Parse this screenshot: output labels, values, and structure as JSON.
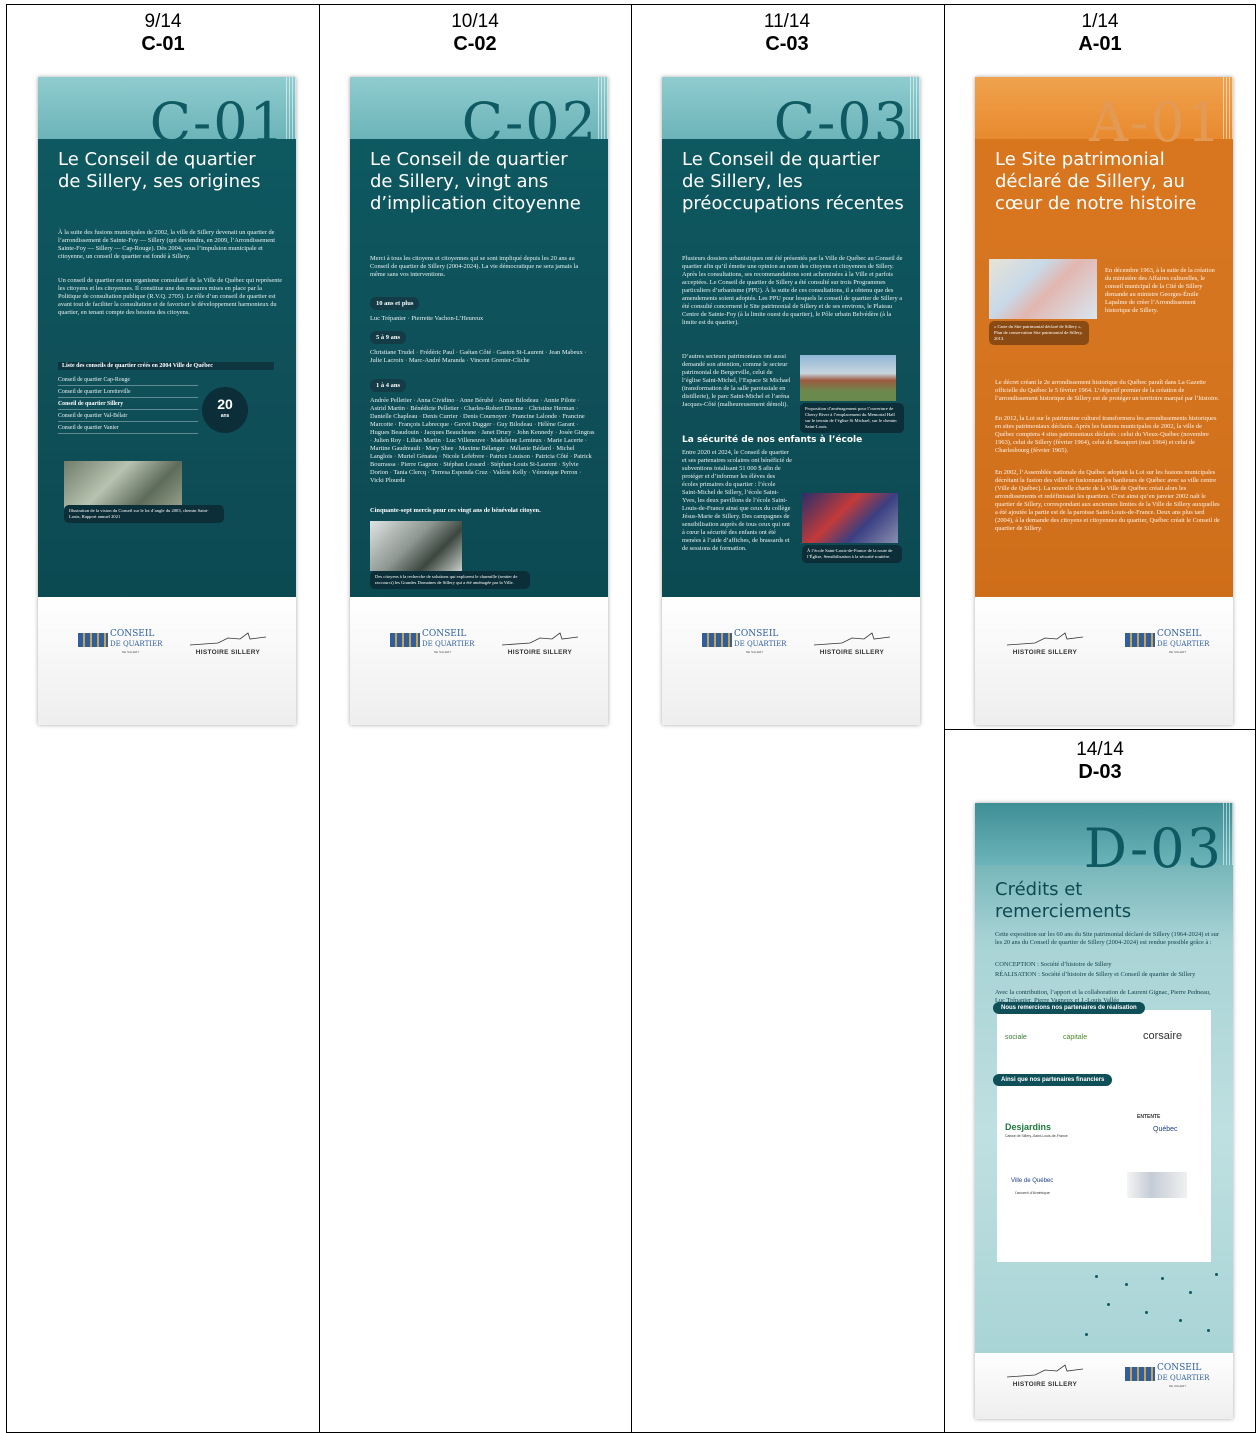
{
  "columns": [
    {
      "num": "9/14",
      "code": "C-01"
    },
    {
      "num": "10/14",
      "code": "C-02"
    },
    {
      "num": "11/14",
      "code": "C-03"
    },
    {
      "num": "1/14",
      "code": "A-01"
    }
  ],
  "extra_cell": {
    "num": "14/14",
    "code": "D-03"
  },
  "panels": {
    "c01": {
      "code": "C-01",
      "title": "Le Conseil de quartier de Sillery, ses origines",
      "p1": "À la suite des fusions municipales de 2002, la ville de Sillery devenait un quartier de l’arrondissement de Sainte-Foy — Sillery (qui deviendra, en 2009, l’Arrondissement Sainte-Foy — Sillery — Cap-Rouge). Dès 2004, sous l’impulsion municipale et citoyenne, un conseil de quartier est fondé à Sillery.",
      "p2": "Un conseil de quartier est un organisme consultatif de la Ville de Québec qui représente les citoyens et les citoyennes. Il constitue une des mesures mises en place par la Politique de consultation publique (R.V.Q. 2705). Le rôle d’un conseil de quartier est avant tout de faciliter la consultation et de favoriser le développement harmonieux du quartier, en tenant compte des besoins des citoyens.",
      "list_title": "Liste des conseils de quartier créés en 2004 Ville de Québec",
      "list": [
        "Conseil de quartier Cap-Rouge",
        "Conseil de quartier Loretteville",
        "Conseil de quartier Sillery",
        "Conseil de quartier Val-Bélair",
        "Conseil de quartier Vanier"
      ],
      "badge_num": "20",
      "badge_unit": "ans",
      "caption": "Illustration de la vision du Conseil sur le lot d’angle du 2003, chemin Saint-Louis, Rapport annuel 2021"
    },
    "c02": {
      "code": "C-02",
      "title": "Le Conseil de quartier de Sillery, vingt ans d’implication citoyenne",
      "intro": "Merci à tous les citoyens et citoyennes qui se sont impliqué depuis les 20 ans au Conseil de quartier de Sillery (2004-2024). La vie démocratique ne sera jamais la même sans vos interventions.",
      "g1": "10 ans et plus",
      "g1_names": "Luc Trépanier · Pierrette Vachon-L’Heureux",
      "g2": "5 à 9 ans",
      "g2_names": "Christiane Trudel · Frédéric Paul · Gaétan Côté · Gaston St-Laurent · Jean Mabeux · Julie Lacroix · Marc-André Maranda · Vincent Grenier-Cliche",
      "g3": "1 à 4 ans",
      "g3_names": "Andrée Pelletier · Anna Cividino · Anne Bérubé · Annie Bilodeau · Annie Pilote · Astrid Martin · Bénédicte Pelletier · Charles-Robert Dionne · Christine Herman · Danielle Chapleau · Denis Currier · Denis Cournoyer · Francine Lalonde · Francine Marcotte · François Labrecque · Gervit Dugger · Guy Bilodeau · Hélène Garant · Hugues Beaudouin · Jacques Beauchesne · Janet Drury · John Kennedy · Josée Gingras · Julien Roy · Lilian Martin · Luc Villeneuve · Madeleine Lemieux · Marie Lacerte · Martine Gaudreault · Mary Shee · Maxime Bélanger · Mélanie Bédard · Michel Langlois · Muriel Génatas · Nicole Lefebvre · Patrice Louison · Patricia Côté · Patrick Bourrassa · Pierre Gagnon · Stéphan Lessard · Stéphan-Louis St-Laurent · Sylvie Dorion · Tania Clercq · Terresa Esponda Cruz · Valérie Kelly · Véronique Perron · Vicki Plourde",
      "closing": "Cinquante-sept mercis pour ces vingt ans de bénévolat citoyen.",
      "caption": "Des citoyens à la recherche de solutions qui explorent le charmille (sentier de raccourci) les Grandes Domaines de Sillery qui a été aménagée par la Ville."
    },
    "c03": {
      "code": "C-03",
      "title": "Le Conseil de quartier de Sillery, les préoccupations récentes",
      "p1": "Plusieurs dossiers urbanistiques ont été présentés par la Ville de Québec au Conseil de quartier afin qu’il émette une opinion au nom des citoyens et citoyennes de Sillery. Après les consultations, ses recommandations sont acheminées à la Ville et parfois acceptées. Le Conseil de quartier de Sillery a été consulté sur trois Programmes particuliers d’urbanisme (PPU). À la suite de ces consultations, il a obtenu que des amendements soient adoptés. Les PPU pour lesquels le conseil de quartier de Sillery a été consulté concernent le Site patrimonial de Sillery et de ses environs, le Plateau Centre de Sainte-Foy (à la limite ouest du quartier), le Pôle urbain Belvédère (à la limite est du quartier).",
      "p2": "D’autres secteurs patrimoniaux ont aussi demandé son attention, comme le secteur patrimonial de Bergerville, celui de l’église Saint-Michel, l’Espace St Michael (transformation de la salle paroissiale en distillerie), le parc Saint-Michel et l’aréna Jacques-Côté (malheureusement démoli).",
      "cap1": "Proposition d’aménagement pour l’ouverture de Cherry River à l’emplacement du Memorial Hall sur le terrain de l’église St Michael, sur le chemin Saint-Louis.",
      "sub": "La sécurité de nos enfants à l’école",
      "p3": "Entre 2020 et 2024, le Conseil de quartier et ses partenaires scolaires ont bénéficié de subventions totalisant 51 000 $ afin de protéger et d’informer les élèves des écoles primaires du quartier : l’école Saint-Michel de Sillery, l’école Saint-Yves, les deux pavillons de l’école Saint-Louis-de-France ainsi que ceux du collège Jésus-Marie de Sillery. Des campagnes de sensibilisation auprès de tous ceux qui ont à cœur la sécurité des enfants ont été menées à l’aide d’affiches, de brassards et de sessions de formation.",
      "cap2": "À l’école Saint-Louis-de-France de la route de l’Église, Sensibilisation à la sécurité routière."
    },
    "a01": {
      "code": "A-01",
      "title": "Le Site patrimonial déclaré de Sillery, au cœur de notre histoire",
      "side": "En décembre 1963, à la suite de la création du ministère des Affaires culturelles, le conseil municipal de la Cité de Sillery demande au ministre Georges-Émile Lapalme de créer l’Arrondissement historique de Sillery.",
      "map_cap": "« Carte du Site patrimonial déclaré de Sillery », Plan de conservation Site patrimonial de Sillery, 2013.",
      "p1": "Le décret créant le 2e arrondissement historique du Québec paraît dans La Gazette officielle du Québec le 5 février 1964. L’objectif premier de la création de l’arrondissement historique de Sillery est de protéger un territoire marqué par l’histoire.",
      "p2": "En 2012, la Loi sur le patrimoine culturel transformera les arrondissements historiques en sites patrimoniaux déclarés. Après les fusions municipales de 2002, la ville de Québec comptera 4 sites patrimoniaux déclarés : celui du Vieux-Québec (novembre 1963), celui de Sillery (février 1964), celui de Beauport (mai 1964) et celui de Charlesbourg (février 1965).",
      "p3": "En 2002, l’Assemblée nationale du Québec adoptait la Loi sur les fusions municipales décrétant la fusion des villes et fusionnant les banlieues de Québec avec sa ville centre (Ville de Québec). La nouvelle charte de la Ville de Québec créait alors les arrondissements et redéfinissait les quartiers. C’est ainsi qu’en janvier 2002 naît le quartier de Sillery, correspondant aux anciennes limites de la Ville de Sillery auxquelles a été ajoutée la partie est de la paroisse Saint-Louis-de-France. Deux ans plus tard (2004), à la demande des citoyens et citoyennes du quartier, Québec créait le Conseil de quartier de Sillery."
    },
    "d03": {
      "code": "D-03",
      "title": "Crédits et remerciements",
      "p1": "Cette exposition sur les 60 ans du Site patrimonial déclaré de Sillery (1964-2024) et sur les 20 ans du Conseil de quartier de Sillery (2004-2024) est rendue possible grâce à :",
      "conception": "CONCEPTION : Société d’histoire de Sillery",
      "realisation": "RÉALISATION : Société d’histoire de Sillery et Conseil de quartier de Sillery",
      "p2": "Avec la contribution, l’apport et la collaboration de Laurent Gignac, Pierre Pedneau, Luc Trépanier, Pierre Vagneux et J.-Louis Vallée",
      "chip1": "Nous remercions nos partenaires de réalisation",
      "chip2": "Ainsi que nos partenaires financiers",
      "logos_real": [
        "sociale",
        "capitale",
        "corsaire"
      ],
      "logos_fin": [
        "Desjardins",
        "Caisse de Sillery–Saint-Louis-de-France",
        "ENTENTE",
        "Québec",
        "Ville de Québec",
        "l’accent d’Amérique"
      ]
    }
  },
  "footer_logos": {
    "cq_line1": "CONSEIL",
    "cq_line2": "DE QUARTIER",
    "cq_line3": "DE SILLERY",
    "hs": "HISTOIRE SILLERY"
  }
}
